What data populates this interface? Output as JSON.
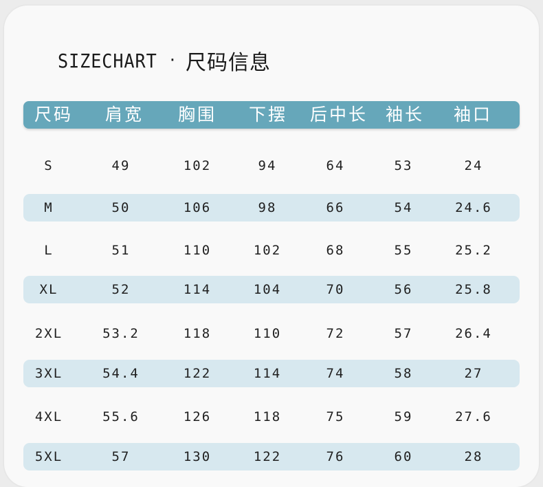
{
  "title": {
    "latin": "SIZECHART",
    "separator": "·",
    "cjk": "尺码信息"
  },
  "columns": [
    "尺码",
    "肩宽",
    "胸围",
    "下摆",
    "后中长",
    "袖长",
    "袖口"
  ],
  "rows": [
    [
      "S",
      "49",
      "102",
      "94",
      "64",
      "53",
      "24"
    ],
    [
      "M",
      "50",
      "106",
      "98",
      "66",
      "54",
      "24.6"
    ],
    [
      "L",
      "51",
      "110",
      "102",
      "68",
      "55",
      "25.2"
    ],
    [
      "XL",
      "52",
      "114",
      "104",
      "70",
      "56",
      "25.8"
    ],
    [
      "2XL",
      "53.2",
      "118",
      "110",
      "72",
      "57",
      "26.4"
    ],
    [
      "3XL",
      "54.4",
      "122",
      "114",
      "74",
      "58",
      "27"
    ],
    [
      "4XL",
      "55.6",
      "126",
      "118",
      "75",
      "59",
      "27.6"
    ],
    [
      "5XL",
      "57",
      "130",
      "122",
      "76",
      "60",
      "28"
    ]
  ],
  "colors": {
    "header": "#66a7ba",
    "band": "#d7e8ef",
    "text": "#1f1f1f"
  }
}
